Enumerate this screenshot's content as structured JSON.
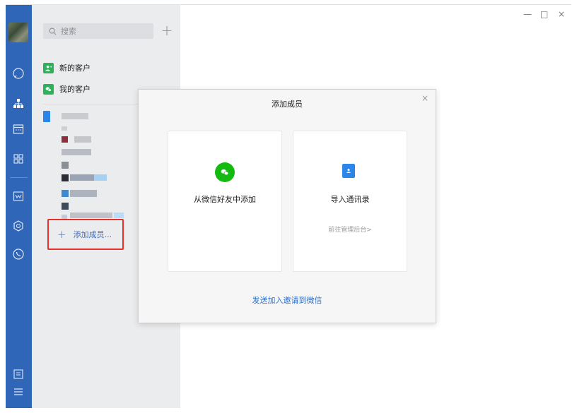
{
  "colors": {
    "nav_bg": "#2f66b8",
    "panel_bg": "#ebecee",
    "accent_blue": "#3d6fc2",
    "wechat_green": "#15ba11",
    "highlight_red": "#e8302b"
  },
  "window_controls": {
    "minimize": "—",
    "maximize": "□",
    "close": "×"
  },
  "sidebar": {
    "icons": [
      "chat-icon",
      "org-chart-icon",
      "calendar-icon",
      "apps-grid-icon",
      "mail-icon",
      "cube-icon",
      "phone-icon",
      "notes-icon",
      "menu-icon"
    ]
  },
  "panel": {
    "search_placeholder": "搜索",
    "add_symbol": "+",
    "rows": [
      {
        "label": "新的客户",
        "icon": "new-customer-icon"
      },
      {
        "label": "我的客户",
        "icon": "my-customer-icon"
      }
    ],
    "add_member_label": "添加成员..."
  },
  "dialog": {
    "title": "添加成员",
    "close": "×",
    "option_wechat": "从微信好友中添加",
    "option_import": "导入通讯录",
    "option_import_sub": "前往管理后台>",
    "invite_link": "发送加入邀请到微信"
  }
}
